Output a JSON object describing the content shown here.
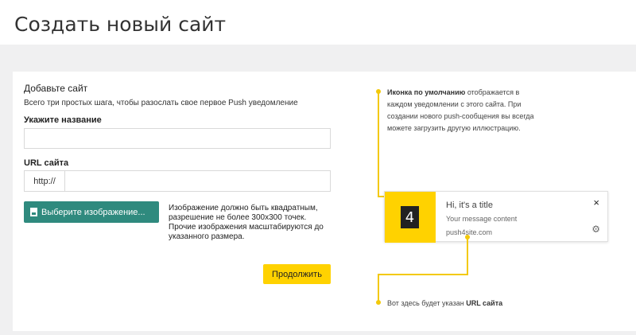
{
  "header": {
    "title": "Создать новый сайт"
  },
  "form": {
    "section_title": "Добавьте сайт",
    "section_subtitle": "Всего три простых шага, чтобы разослать свое первое Push уведомление",
    "name_label": "Укажите название",
    "name_value": "",
    "url_label": "URL сайта",
    "url_prefix": "http://",
    "url_value": "",
    "upload_button": "Выберите изображение...",
    "upload_note": "Изображение должно быть квадратным, разрешение не более 300x300 точек. Прочие изображения масштабируются до указанного размера.",
    "continue_button": "Продолжить"
  },
  "preview": {
    "top_note_bold": "Иконка по умолчанию",
    "top_note_text": " отображается в каждом уведомлении с этого сайта. При создании нового push-сообщения вы всегда можете загрузить другую иллюстрацию.",
    "notification": {
      "icon_char": "4",
      "title": "Hi, it's a title",
      "message": "Your message content",
      "url": "push4site.com",
      "close_symbol": "×",
      "gear_symbol": "⚙"
    },
    "bottom_note_text": "Вот здесь будет указан ",
    "bottom_note_bold": "URL сайта"
  },
  "colors": {
    "accent_yellow": "#ffd200",
    "button_teal": "#2f8a7e",
    "annotation_line": "#f3c90b"
  }
}
